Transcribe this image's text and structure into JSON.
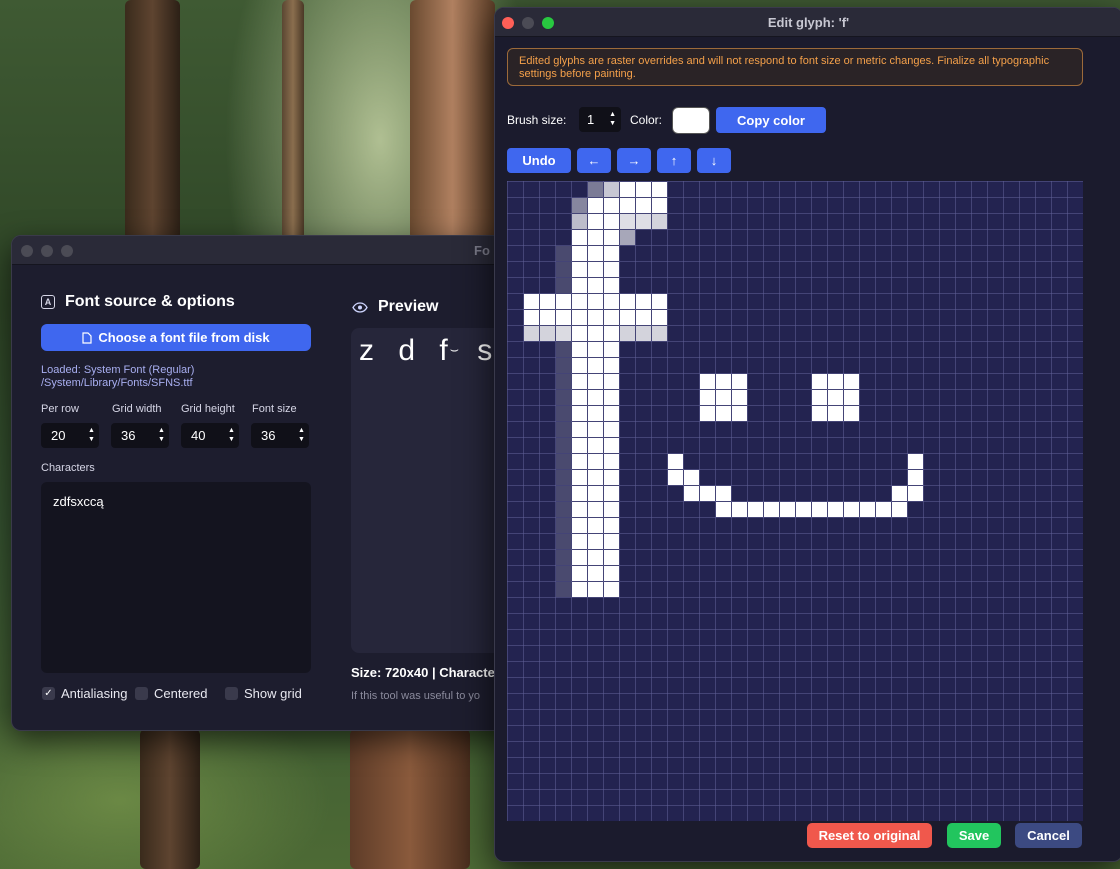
{
  "colors": {
    "accent": "#3f67ef",
    "warning_text": "#f4a04a",
    "reset": "#f0584c",
    "save": "#22c55e",
    "cancel": "#3c4a82",
    "canvas_bg": "#232350",
    "pixel_white": "#ffffff"
  },
  "back_window": {
    "title": "Fo",
    "source_section": {
      "heading": "Font source & options",
      "choose_button": "Choose a font file from disk",
      "loaded_line1": "Loaded: System Font (Regular)",
      "loaded_line2": "/System/Library/Fonts/SFNS.ttf",
      "fields": [
        {
          "label": "Per row",
          "value": "20"
        },
        {
          "label": "Grid width",
          "value": "36"
        },
        {
          "label": "Grid height",
          "value": "40"
        },
        {
          "label": "Font size",
          "value": "36"
        }
      ],
      "characters_label": "Characters",
      "characters_value": "zdfsxccą",
      "checkboxes": [
        {
          "label": "Antialiasing",
          "checked": true
        },
        {
          "label": "Centered",
          "checked": false
        },
        {
          "label": "Show grid",
          "checked": false
        }
      ]
    },
    "preview_section": {
      "heading": "Preview",
      "glyphs": "z d f·̤̈ s",
      "glyph_z": "z",
      "glyph_d": "d",
      "glyph_f": "f",
      "glyph_s": "s",
      "size_text": "Size: 720x40 | Characte",
      "footer_text": "If this tool was useful to yo"
    }
  },
  "glyph_editor": {
    "title": "Edit glyph: 'f'",
    "warning": "Edited glyphs are raster overrides and will not respond to font size or metric changes. Finalize all typographic settings before painting.",
    "brush_label": "Brush size:",
    "brush_value": "1",
    "color_label": "Color:",
    "color_value": "#ffffff",
    "copy_color_button": "Copy color",
    "undo_button": "Undo",
    "shift_buttons": [
      {
        "name": "shift-left",
        "icon": "arrow-left-icon",
        "glyph": "←"
      },
      {
        "name": "shift-right",
        "icon": "arrow-right-icon",
        "glyph": "→"
      },
      {
        "name": "shift-up",
        "icon": "arrow-up-icon",
        "glyph": "↑"
      },
      {
        "name": "shift-down",
        "icon": "arrow-down-icon",
        "glyph": "↓"
      }
    ],
    "grid": {
      "columns": 36,
      "rows": 40
    },
    "reset_button": "Reset to original",
    "save_button": "Save",
    "cancel_button": "Cancel"
  }
}
